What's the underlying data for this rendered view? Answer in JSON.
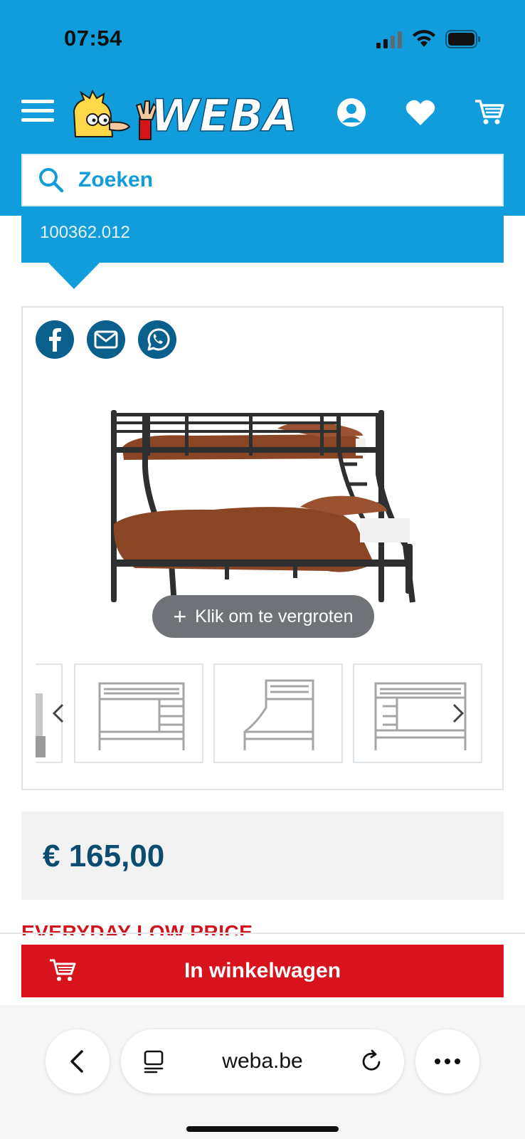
{
  "status_bar": {
    "time": "07:54"
  },
  "header": {
    "brand": "WEBA",
    "search": {
      "label": "Zoeken"
    }
  },
  "product": {
    "sku": "100362.012",
    "zoom_label": "Klik om te vergroten",
    "price": "€ 165,00",
    "price_tag": "EVERYDAY LOW PRICE",
    "add_to_cart_label": "In winkelwagen",
    "share_icons": [
      "facebook-icon",
      "mail-icon",
      "whatsapp-icon"
    ],
    "thumbnails": [
      "bunk-bed-partial",
      "bunk-bed-front",
      "bunk-bed-side",
      "bunk-bed-front-2"
    ]
  },
  "browser": {
    "url": "weba.be"
  },
  "colors": {
    "brand_blue": "#119ddb",
    "dark_blue": "#0b4d71",
    "cta_red": "#d7141c"
  }
}
